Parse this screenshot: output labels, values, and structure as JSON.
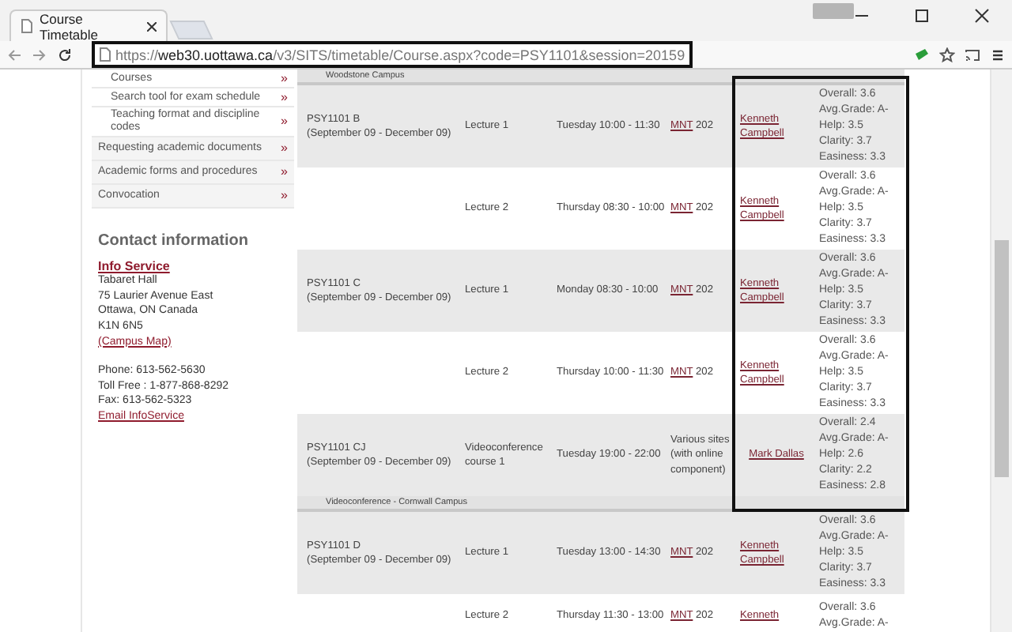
{
  "browser": {
    "tab_title": "Course Timetable",
    "url": {
      "scheme": "https://",
      "host": "web30.uottawa.ca",
      "path": "/v3/SITS/timetable/Course.aspx?code=PSY1101&session=20159"
    }
  },
  "sidebar": {
    "items": [
      {
        "kind": "sub",
        "label": "Courses",
        "marker": "»"
      },
      {
        "kind": "sub",
        "label": "Search tool for exam schedule",
        "marker": "»"
      },
      {
        "kind": "sub",
        "label": "Teaching format and discipline codes",
        "marker": "»"
      },
      {
        "kind": "main",
        "label": "Requesting academic documents",
        "marker": "»"
      },
      {
        "kind": "main",
        "label": "Academic forms and procedures",
        "marker": "»"
      },
      {
        "kind": "main",
        "label": "Convocation",
        "marker": "»"
      }
    ]
  },
  "contact": {
    "heading": "Contact information",
    "service_link": "Info Service",
    "address": [
      "Tabaret Hall",
      "75 Laurier Avenue East",
      "Ottawa, ON Canada",
      "K1N 6N5"
    ],
    "map_link": "(Campus Map)",
    "phones": [
      "Phone: 613-562-5630",
      "Toll Free : 1-877-868-8292",
      "Fax: 613-562-5323"
    ],
    "email_link": "Email InfoService"
  },
  "table": {
    "rows": [
      {
        "kind": "section",
        "label": "Woodstone Campus"
      },
      {
        "kind": "class",
        "section": "PSY1101 B",
        "dates": "(September 09 - December 09)",
        "activity": "Lecture 1",
        "time": "Tuesday 10:00 - 11:30",
        "room_code": "MNT",
        "room_number": "202",
        "professor": "Kenneth Campbell",
        "ratings": [
          "Overall: 3.6",
          "Avg.Grade: A-",
          "Help: 3.5",
          "Clarity: 3.7",
          "Easiness: 3.3"
        ]
      },
      {
        "kind": "class",
        "activity": "Lecture 2",
        "time": "Thursday 08:30 - 10:00",
        "room_code": "MNT",
        "room_number": "202",
        "professor": "Kenneth Campbell",
        "ratings": [
          "Overall: 3.6",
          "Avg.Grade: A-",
          "Help: 3.5",
          "Clarity: 3.7",
          "Easiness: 3.3"
        ]
      },
      {
        "kind": "class",
        "section": "PSY1101 C",
        "dates": "(September 09 - December 09)",
        "activity": "Lecture 1",
        "time": "Monday 08:30 - 10:00",
        "room_code": "MNT",
        "room_number": "202",
        "professor": "Kenneth Campbell",
        "ratings": [
          "Overall: 3.6",
          "Avg.Grade: A-",
          "Help: 3.5",
          "Clarity: 3.7",
          "Easiness: 3.3"
        ]
      },
      {
        "kind": "class",
        "activity": "Lecture 2",
        "time": "Thursday 10:00 - 11:30",
        "room_code": "MNT",
        "room_number": "202",
        "professor": "Kenneth Campbell",
        "ratings": [
          "Overall: 3.6",
          "Avg.Grade: A-",
          "Help: 3.5",
          "Clarity: 3.7",
          "Easiness: 3.3"
        ]
      },
      {
        "kind": "class",
        "section": "PSY1101 CJ",
        "dates": "(September 09 - December 09)",
        "activity": "Videoconference course 1",
        "time": "Tuesday 19:00 - 22:00",
        "room_text": "Various sites (with online component)",
        "professor": "Mark Dallas",
        "ratings": [
          "Overall: 2.4",
          "Avg.Grade: A-",
          "Help: 2.6",
          "Clarity: 2.2",
          "Easiness: 2.8"
        ]
      },
      {
        "kind": "section",
        "label": "Videoconference - Cornwall Campus"
      },
      {
        "kind": "class",
        "section": "PSY1101 D",
        "dates": "(September 09 - December 09)",
        "activity": "Lecture 1",
        "time": "Tuesday 13:00 - 14:30",
        "room_code": "MNT",
        "room_number": "202",
        "professor": "Kenneth Campbell",
        "ratings": [
          "Overall: 3.6",
          "Avg.Grade: A-",
          "Help: 3.5",
          "Clarity: 3.7",
          "Easiness: 3.3"
        ]
      },
      {
        "kind": "class",
        "activity": "Lecture 2",
        "time": "Thursday 11:30 - 13:00",
        "room_code": "MNT",
        "room_number": "202",
        "professor": "Kenneth",
        "ratings": [
          "Overall: 3.6",
          "Avg.Grade: A-"
        ]
      }
    ]
  }
}
